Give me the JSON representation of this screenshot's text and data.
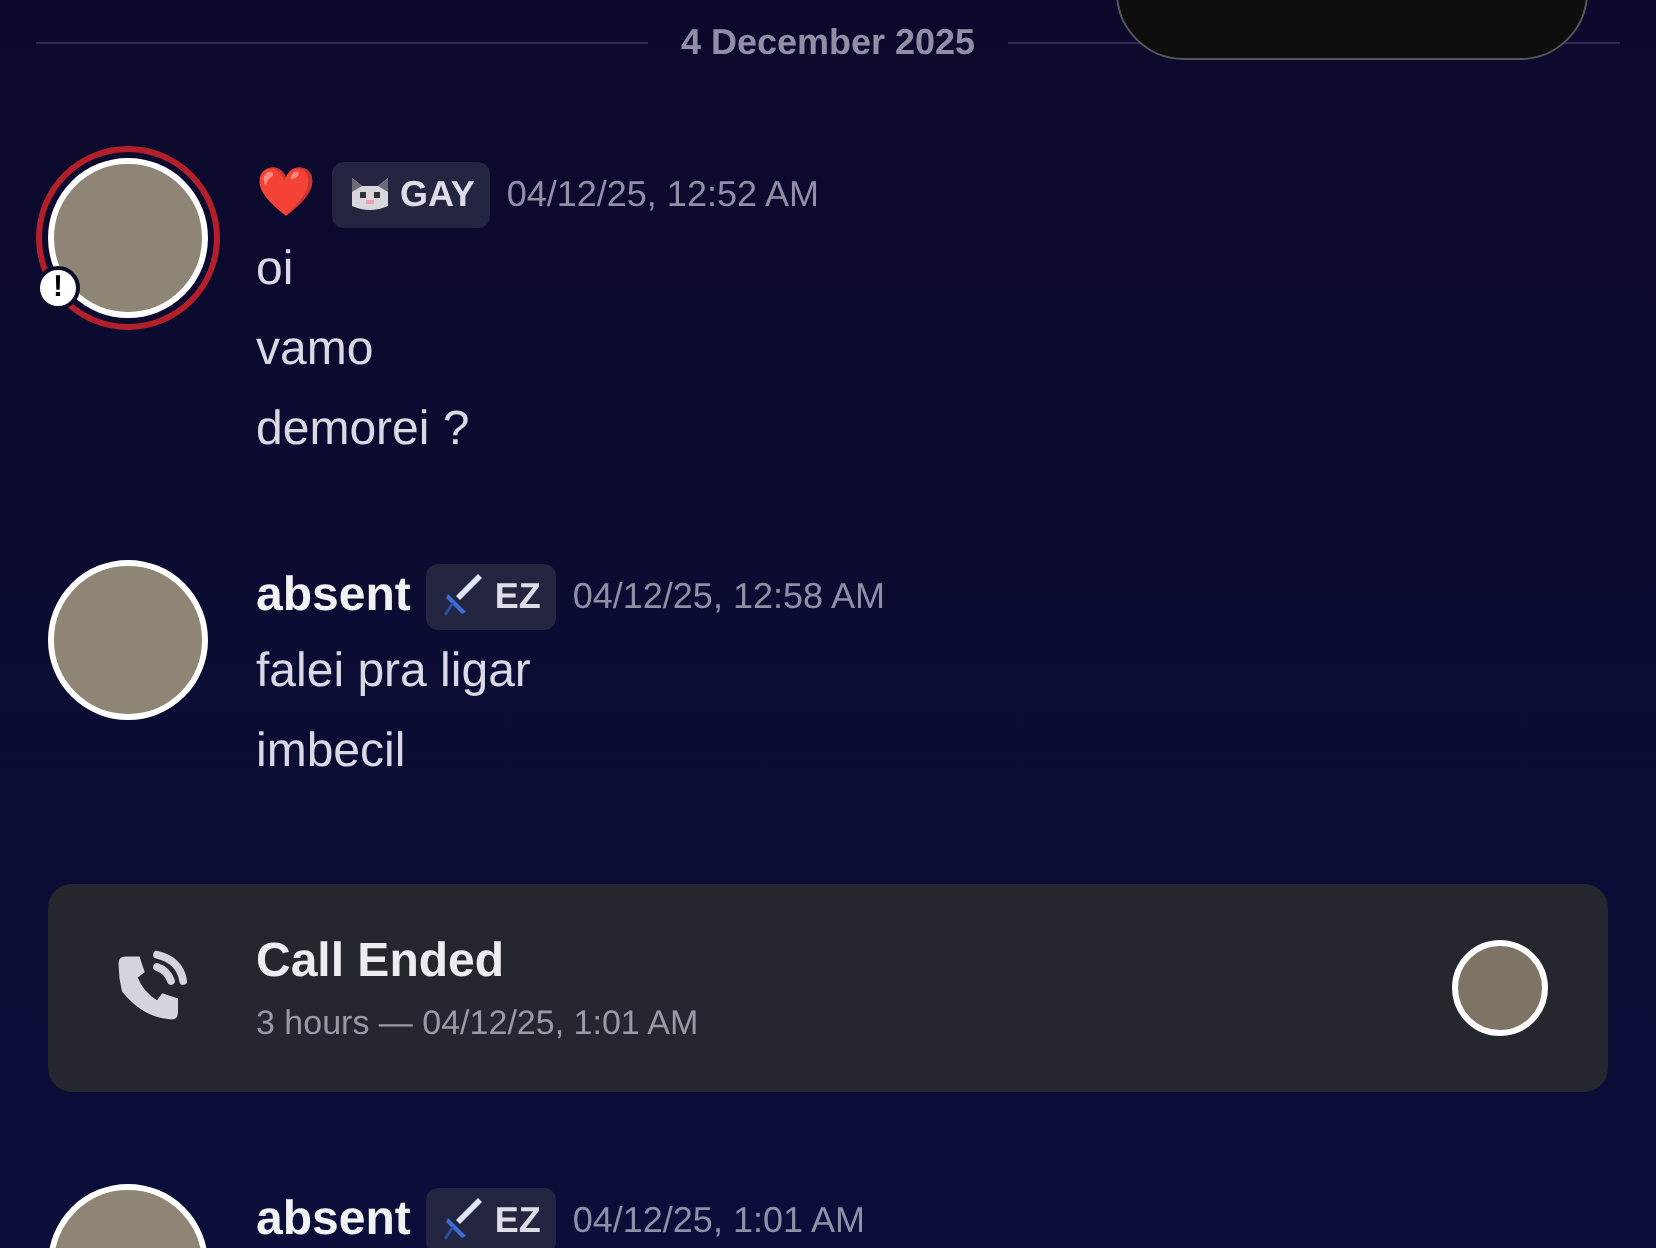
{
  "date_divider": "4 December 2025",
  "feed": [
    {
      "kind": "message",
      "author": "❤️",
      "avatar_badge": "!",
      "tag": {
        "kind": "cat",
        "label": "GAY"
      },
      "time": "04/12/25, 12:52 AM",
      "lines": [
        "oi",
        "vamo",
        "demorei ?"
      ]
    },
    {
      "kind": "message",
      "author": "absent",
      "tag": {
        "kind": "sword",
        "label": "EZ"
      },
      "time": "04/12/25, 12:58 AM",
      "lines": [
        "falei pra ligar",
        "imbecil"
      ]
    },
    {
      "kind": "call",
      "title": "Call Ended",
      "detail": "3 hours — 04/12/25, 1:01 AM"
    },
    {
      "kind": "message",
      "author": "absent",
      "tag": {
        "kind": "sword",
        "label": "EZ"
      },
      "time": "04/12/25, 1:01 AM"
    }
  ]
}
